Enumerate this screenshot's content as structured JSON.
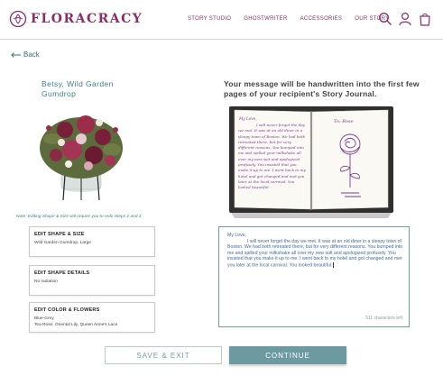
{
  "header": {
    "brand": "FLORACRACY",
    "nav": [
      "STORY STUDIO",
      "GHOSTWRITER",
      "ACCESSORIES",
      "OUR STORY"
    ],
    "icons": [
      "search-icon",
      "account-icon",
      "bag-icon"
    ]
  },
  "back_label": "Back",
  "product": {
    "name": "Betsy, Wild Garden Gumdrop",
    "note": "Note: Editing Shape & Size will require you to redo Steps 2 and 3"
  },
  "edits": [
    {
      "title": "EDIT SHAPE & SIZE",
      "value": "Wild Garden Gumdrop, Large"
    },
    {
      "title": "EDIT SHAPE DETAILS",
      "value": "No radiation"
    },
    {
      "title": "EDIT COLOR & FLOWERS",
      "value": "Blue-Grey\nTea Rose, Oriental Lily, Queen Anne's Lace"
    }
  ],
  "headline": "Your message will be handwritten into the first few pages of your recipient's Story Journal.",
  "journal": {
    "salutation": "My Love,",
    "page_text": "I will never forget the day we met. It was at an old diner in a sleepy town of Boston. We had both retreated there, but for very different reasons. You bumped into me and spilled your milkshake all over my new suit and apologized profusely. You insisted that you make it up to me. I went back to my hotel and got changed and met you later at the local carnival. You looked beautiful.",
    "to_label": "To: Rose"
  },
  "message": {
    "salutation": "My Love,",
    "body": "I will never forget the day we met. It was at an old diner in a sleepy town of Boston. We had both retreated there, but for very different reasons. You bumped into me and spilled your milkshake all over my new suit and apologized profusely. You insisted that you make it up to me. I went back to my hotel and got changed and met you later at the local carnival. You looked beautiful.",
    "counter": "511 characters left"
  },
  "buttons": {
    "save": "SAVE & EXIT",
    "continue": "CONTINUE"
  },
  "colors": {
    "brand": "#8a2e6a",
    "teal": "#3f7f8c",
    "continue_bg": "#6c9aa0",
    "message_border": "#6aa597"
  }
}
